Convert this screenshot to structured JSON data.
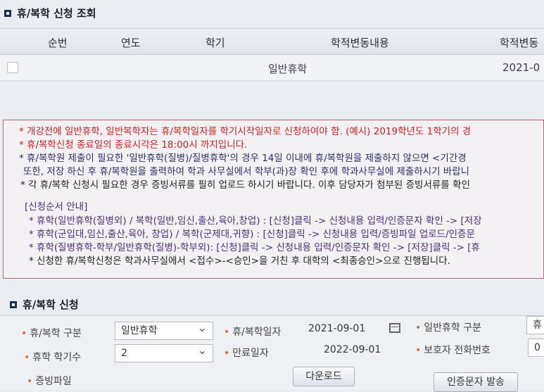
{
  "inquiry": {
    "title": "휴/복학 신청 조회",
    "columns": [
      "순번",
      "연도",
      "학기",
      "학적변동내용",
      "학적변동"
    ],
    "rows": [
      {
        "content": "일반휴학",
        "date": "2021-0"
      }
    ]
  },
  "notice": {
    "lines": [
      "* 개강전에 일반휴학, 일반복학자는 휴/복학일자를 학기시작일자로 신청하여야 함. (예시) 2019학년도 1학기의 경",
      "* 휴/복학신청 종료일의 종료시각은 18:00시 까지입니다.",
      "* 휴/복학원 제출이 필요한 '일반휴학(질병)/질병휴학'의 경우 14일 이내에 휴/복학원을 제출하지 않으면 <기간경",
      "또한, 저장 하신 후 휴/복학원을 출력하여 학과 사무실에서 학부(과)장 확인 후에 학과사무실에 제출하시기 바랍니",
      "* 각 휴/복학 신청시 필요한 경우 증빙서류를 필히 업로드 하시기 바랍니다. 이후 담당자가 첨부된 증빙서류를 확인",
      "[신청순서 안내]",
      "* 휴학(일반휴학(질병외) / 복학(일반,임신,출산,육아,창업) : [신청]클릭 -> 신청내용 입력/인증문자 확인 -> [저장",
      "* 휴학(군입대,임신,출산,육아, 창업) / 복학(군제대,귀향) : [신청]클릭 -> 신청내용 입력/증빙파일 업로드/인증문",
      "* 휴학(질병휴학-학부/일반휴학(질병)-학부외): [신청]클릭 -> 신청내용 입력/인증문자 확인 -> [저장]클릭 -> [휴",
      "* 신청한 휴/복학신청은 학과사무실에서 <접수>-<승인>을 거친 후 대학의 <최종승인>으로 진행됩니다."
    ]
  },
  "apply": {
    "title": "휴/복학 신청",
    "type_label": "휴/복학 구분",
    "type_value": "일반휴학",
    "date_label": "휴/복학일자",
    "date_value": "2021-09-01",
    "general_label": "일반휴학 구분",
    "general_value": "휴",
    "count_label": "휴학 학기수",
    "count_value": "2",
    "end_label": "만료일자",
    "end_value": "2022-09-01",
    "guardian_label": "보호자 전화번호",
    "guardian_value": "0",
    "file_label": "증빙파일",
    "download_button": "다운로드",
    "sms_button": "인증문자 발송"
  },
  "colors": {
    "accent_red": "#c62222",
    "navy": "#2a2f6a",
    "bullet": "#e06b2a"
  }
}
